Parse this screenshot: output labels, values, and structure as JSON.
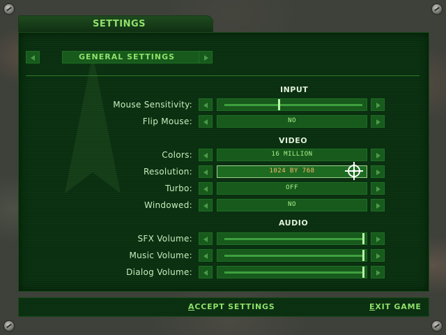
{
  "window": {
    "tab_title": "SETTINGS"
  },
  "category": {
    "label": "GENERAL SETTINGS"
  },
  "sections": {
    "input": "INPUT",
    "video": "VIDEO",
    "audio": "AUDIO"
  },
  "settings": {
    "mouse_sensitivity": {
      "label": "Mouse Sensitivity:",
      "level": 0.42
    },
    "flip_mouse": {
      "label": "Flip Mouse:",
      "value": "NO"
    },
    "colors": {
      "label": "Colors:",
      "value": "16 MILLION"
    },
    "resolution": {
      "label": "Resolution:",
      "value": "1024 BY 768"
    },
    "turbo": {
      "label": "Turbo:",
      "value": "OFF"
    },
    "windowed": {
      "label": "Windowed:",
      "value": "NO"
    },
    "sfx_volume": {
      "label": "SFX Volume:",
      "level": 1.0
    },
    "music_volume": {
      "label": "Music Volume:",
      "level": 1.0
    },
    "dialog_volume": {
      "label": "Dialog Volume:",
      "level": 1.0
    }
  },
  "footer": {
    "accept_first": "A",
    "accept_rest": "CCEPT SETTINGS",
    "exit_first": "E",
    "exit_rest": "XIT GAME"
  },
  "colors": {
    "panel": "#0b3010",
    "text_green": "#8fe06a",
    "value_green": "#a8f08a",
    "highlight": "#ffb86a"
  },
  "icons": [
    "left-arrow-icon",
    "right-arrow-icon",
    "crosshair-cursor-icon",
    "rivet-icon"
  ]
}
